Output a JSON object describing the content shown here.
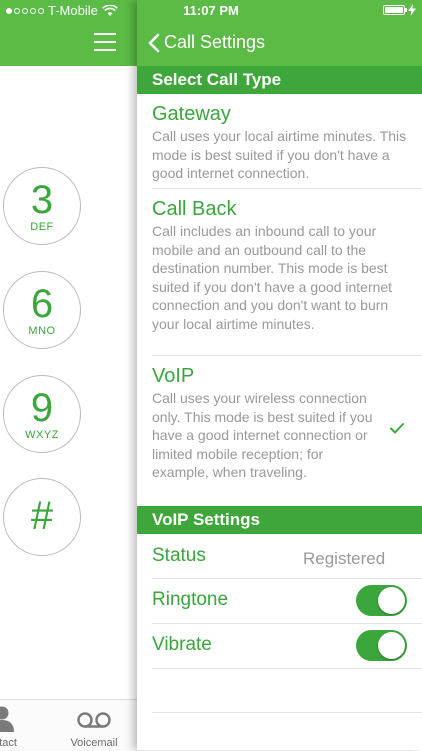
{
  "status_bar": {
    "carrier": "T-Mobile",
    "time": "11:07 PM"
  },
  "dialer": {
    "keys": [
      {
        "digit": "3",
        "letters": "DEF"
      },
      {
        "digit": "6",
        "letters": "MNO"
      },
      {
        "digit": "9",
        "letters": "WXYZ"
      },
      {
        "digit": "#",
        "letters": ""
      }
    ],
    "tabs": {
      "contact": "ontact",
      "voicemail": "Voicemail"
    }
  },
  "nav": {
    "back_label": "Call Settings"
  },
  "call_type": {
    "header": "Select Call Type",
    "options": [
      {
        "title": "Gateway",
        "desc": "Call uses your local airtime minutes. This mode is best suited if you don't have a good internet connection."
      },
      {
        "title": "Call Back",
        "desc": "Call includes an inbound call to your mobile and an outbound call to the destination number. This mode is best suited if you don't have a good internet connection and you don't want to burn your local airtime minutes."
      },
      {
        "title": "VoIP",
        "desc": "Call uses your wireless connection only. This mode is best suited if you have a good internet connection or limited mobile reception; for example, when traveling."
      }
    ],
    "selected": "VoIP"
  },
  "voip": {
    "header": "VoIP Settings",
    "status_label": "Status",
    "status_value": "Registered",
    "ringtone_label": "Ringtone",
    "ringtone_on": true,
    "vibrate_label": "Vibrate",
    "vibrate_on": true
  },
  "colors": {
    "header_green": "#5bbb46",
    "section_green": "#3ea63a",
    "text_green": "#3aa63c",
    "desc_gray": "#999999"
  }
}
